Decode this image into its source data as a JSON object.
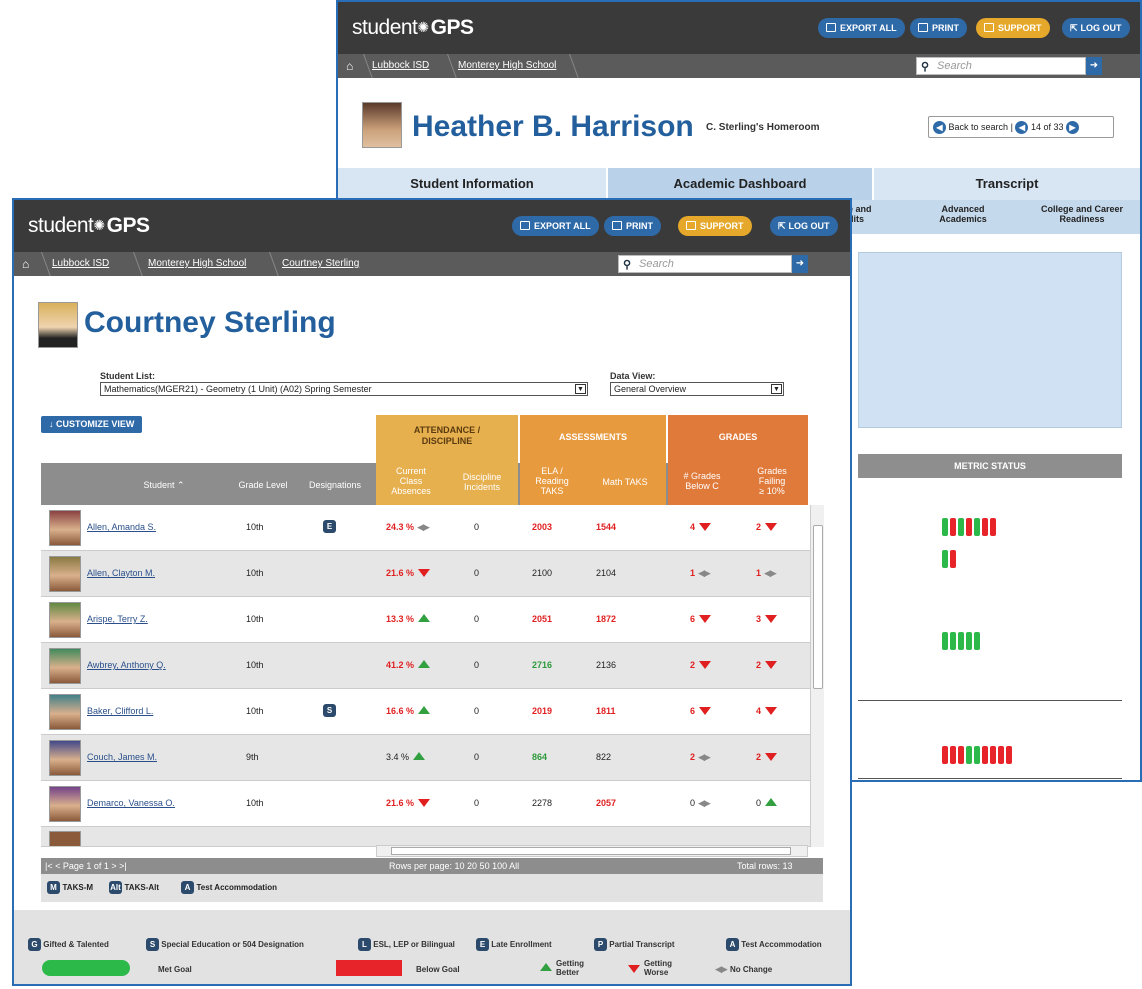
{
  "back": {
    "brand": {
      "a": "student",
      "b": "GPS"
    },
    "buttons": {
      "export": "EXPORT ALL",
      "print": "PRINT",
      "support": "SUPPORT",
      "logout": "LOG OUT"
    },
    "crumbs": [
      "Lubbock ISD",
      "Monterey High School"
    ],
    "search_placeholder": "Search",
    "student_name": "Heather B. Harrison",
    "homeroom": "C. Sterling's Homeroom",
    "nav": {
      "back": "Back to search",
      "sep": "|",
      "count": "14 of 33"
    },
    "tabs": [
      "Student Information",
      "Academic Dashboard",
      "Transcript"
    ],
    "subtabs": [
      "e and\ndits",
      "Advanced\nAcademics",
      "College and Career\nReadiness"
    ],
    "metric_status": "METRIC STATUS",
    "bars": [
      [
        "g",
        "r",
        "g",
        "r",
        "g",
        "r",
        "r"
      ],
      [
        "g",
        "r"
      ],
      [
        "g",
        "g",
        "g",
        "g",
        "g"
      ],
      [
        "r",
        "r",
        "r",
        "g",
        "g",
        "r",
        "r",
        "r",
        "r"
      ]
    ]
  },
  "front": {
    "brand": {
      "a": "student",
      "b": "GPS"
    },
    "buttons": {
      "export": "EXPORT ALL",
      "print": "PRINT",
      "support": "SUPPORT",
      "logout": "LOG OUT"
    },
    "crumbs": [
      "Lubbock ISD",
      "Monterey High School",
      "Courtney Sterling"
    ],
    "search_placeholder": "Search",
    "teacher_name": "Courtney Sterling",
    "student_list_label": "Student List:",
    "student_list_value": "Mathematics(MGER21) - Geometry (1 Unit) (A02) Spring Semester",
    "data_view_label": "Data View:",
    "data_view_value": "General Overview",
    "customize": "CUSTOMIZE VIEW",
    "groups": {
      "att": "ATTENDANCE /\nDISCIPLINE",
      "ass": "ASSESSMENTS",
      "gr": "GRADES"
    },
    "cols": {
      "student": "Student",
      "grade": "Grade Level",
      "desig": "Designations",
      "abs": "Current\nClass\nAbsences",
      "disc": "Discipline\nIncidents",
      "ela": "ELA /\nReading\nTAKS",
      "math": "Math TAKS",
      "below": "# Grades\nBelow C",
      "fail": "Grades\nFailing\n≥ 10%"
    },
    "rows": [
      {
        "name": "Allen, Amanda S.",
        "grade": "10th",
        "desig": "E",
        "abs": "24.3 %",
        "abs_c": "red",
        "abs_t": "nc",
        "disc": "0",
        "ela": "2003",
        "ela_c": "red",
        "math": "1544",
        "math_c": "red",
        "below": "4",
        "below_c": "red",
        "below_t": "dn",
        "fail": "2",
        "fail_c": "red",
        "fail_t": "dn"
      },
      {
        "name": "Allen, Clayton M.",
        "grade": "10th",
        "desig": "",
        "abs": "21.6 %",
        "abs_c": "red",
        "abs_t": "dn",
        "disc": "0",
        "ela": "2100",
        "ela_c": "",
        "math": "2104",
        "math_c": "",
        "below": "1",
        "below_c": "red",
        "below_t": "nc",
        "fail": "1",
        "fail_c": "red",
        "fail_t": "nc"
      },
      {
        "name": "Arispe, Terry Z.",
        "grade": "10th",
        "desig": "",
        "abs": "13.3 %",
        "abs_c": "red",
        "abs_t": "up",
        "disc": "0",
        "ela": "2051",
        "ela_c": "red",
        "math": "1872",
        "math_c": "red",
        "below": "6",
        "below_c": "red",
        "below_t": "dn",
        "fail": "3",
        "fail_c": "red",
        "fail_t": "dn"
      },
      {
        "name": "Awbrey, Anthony Q.",
        "grade": "10th",
        "desig": "",
        "abs": "41.2 %",
        "abs_c": "red",
        "abs_t": "up",
        "disc": "0",
        "ela": "2716",
        "ela_c": "grn",
        "math": "2136",
        "math_c": "",
        "below": "2",
        "below_c": "red",
        "below_t": "dn",
        "fail": "2",
        "fail_c": "red",
        "fail_t": "dn"
      },
      {
        "name": "Baker, Clifford L.",
        "grade": "10th",
        "desig": "S",
        "abs": "16.6 %",
        "abs_c": "red",
        "abs_t": "up",
        "disc": "0",
        "ela": "2019",
        "ela_c": "red",
        "math": "1811",
        "math_c": "red",
        "below": "6",
        "below_c": "red",
        "below_t": "dn",
        "fail": "4",
        "fail_c": "red",
        "fail_t": "dn"
      },
      {
        "name": "Couch, James M.",
        "grade": "9th",
        "desig": "",
        "abs": "3.4 %",
        "abs_c": "",
        "abs_t": "up",
        "disc": "0",
        "ela": "864",
        "ela_c": "grn",
        "math": "822",
        "math_c": "",
        "below": "2",
        "below_c": "red",
        "below_t": "nc",
        "fail": "2",
        "fail_c": "red",
        "fail_t": "dn"
      },
      {
        "name": "Demarco, Vanessa O.",
        "grade": "10th",
        "desig": "",
        "abs": "21.6 %",
        "abs_c": "red",
        "abs_t": "dn",
        "disc": "0",
        "ela": "2278",
        "ela_c": "",
        "math": "2057",
        "math_c": "red",
        "below": "0",
        "below_c": "",
        "below_t": "nc",
        "fail": "0",
        "fail_c": "",
        "fail_t": "up"
      }
    ],
    "pager": "|< < Page 1 of 1 > >|",
    "rows_per_page": "Rows per page: 10 20 50 100 All",
    "total_rows": "Total rows: 13",
    "mini_legend": [
      {
        "b": "M",
        "t": "TAKS-M"
      },
      {
        "b": "Alt",
        "t": "TAKS-Alt"
      },
      {
        "b": "A",
        "t": "Test Accommodation"
      }
    ],
    "legend": [
      {
        "b": "G",
        "t": "Gifted & Talented"
      },
      {
        "b": "S",
        "t": "Special Education or 504 Designation"
      },
      {
        "b": "L",
        "t": "ESL, LEP or Bilingual"
      },
      {
        "b": "E",
        "t": "Late Enrollment"
      },
      {
        "b": "P",
        "t": "Partial Transcript"
      },
      {
        "b": "A",
        "t": "Test Accommodation"
      }
    ],
    "legend2": {
      "met": "Met Goal",
      "below": "Below Goal",
      "better": "Getting\nBetter",
      "worse": "Getting\nWorse",
      "nochange": "No Change"
    },
    "colors": {
      "green": "#2db84a",
      "red": "#e8242b",
      "gold": "#e6b04e",
      "orange": "#e07a3a"
    }
  }
}
